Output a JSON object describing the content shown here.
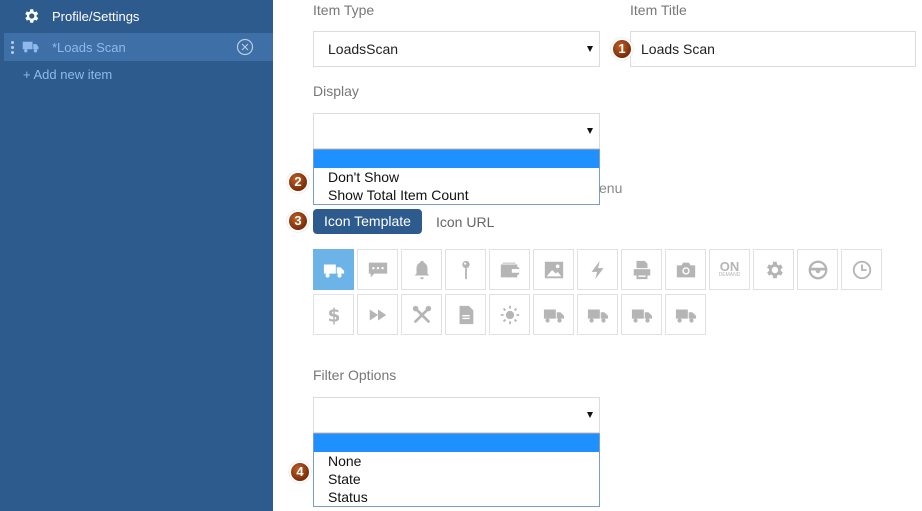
{
  "sidebar": {
    "settings_label": "Profile/Settings",
    "active_item_label": "*Loads Scan",
    "add_item_label": "+ Add new item"
  },
  "form": {
    "item_type": {
      "label": "Item Type",
      "value": "LoadsScan"
    },
    "item_title": {
      "label": "Item Title",
      "value": "Loads Scan"
    },
    "display": {
      "label": "Display",
      "value": "",
      "options": [
        "Don't Show",
        "Show Total Item Count"
      ]
    },
    "menu_fragment": "enu",
    "icon_tabs": [
      "Icon Template",
      "Icon URL"
    ],
    "filter_options": {
      "label": "Filter Options",
      "value": "",
      "options": [
        "None",
        "State",
        "Status"
      ]
    }
  },
  "badges": [
    "1",
    "2",
    "3",
    "4"
  ],
  "icons": [
    "truck-icon",
    "chat-icon",
    "bell-icon",
    "pin-icon",
    "wallet-icon",
    "image-icon",
    "lightning-icon",
    "printer-icon",
    "camera-icon",
    "on-demand-icon",
    "gear-icon",
    "steering-wheel-icon",
    "clock-icon",
    "dollar-icon",
    "fast-forward-icon",
    "tools-icon",
    "document-icon",
    "sun-icon",
    "truck-icon",
    "truck-icon",
    "truck-icon",
    "truck-icon"
  ],
  "on_demand_icon": {
    "big": "ON",
    "small": "DEMAND"
  },
  "colors": {
    "sidebar": "#2e5b8e",
    "accent": "#2e5b8e",
    "selected_icon": "#6cb4e8",
    "badge": "#9a3d12"
  }
}
